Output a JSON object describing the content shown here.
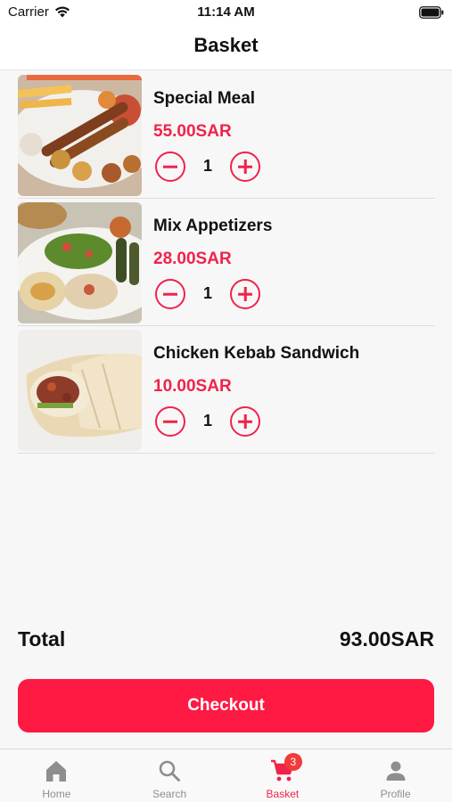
{
  "status_bar": {
    "carrier": "Carrier",
    "time": "11:14 AM"
  },
  "header": {
    "title": "Basket"
  },
  "colors": {
    "accent": "#f0234a",
    "button": "#fe1a43",
    "badge": "#f23a3a"
  },
  "items": [
    {
      "name": "Special Meal",
      "price": "55.00SAR",
      "quantity": "1"
    },
    {
      "name": "Mix Appetizers",
      "price": "28.00SAR",
      "quantity": "1"
    },
    {
      "name": "Chicken Kebab Sandwich",
      "price": "10.00SAR",
      "quantity": "1"
    }
  ],
  "summary": {
    "total_label": "Total",
    "total_value": "93.00SAR"
  },
  "checkout": {
    "label": "Checkout"
  },
  "tab_bar": {
    "tabs": [
      {
        "label": "Home",
        "icon": "home-icon"
      },
      {
        "label": "Search",
        "icon": "search-icon"
      },
      {
        "label": "Basket",
        "icon": "cart-icon",
        "badge": "3",
        "active": true
      },
      {
        "label": "Profile",
        "icon": "profile-icon"
      }
    ]
  }
}
